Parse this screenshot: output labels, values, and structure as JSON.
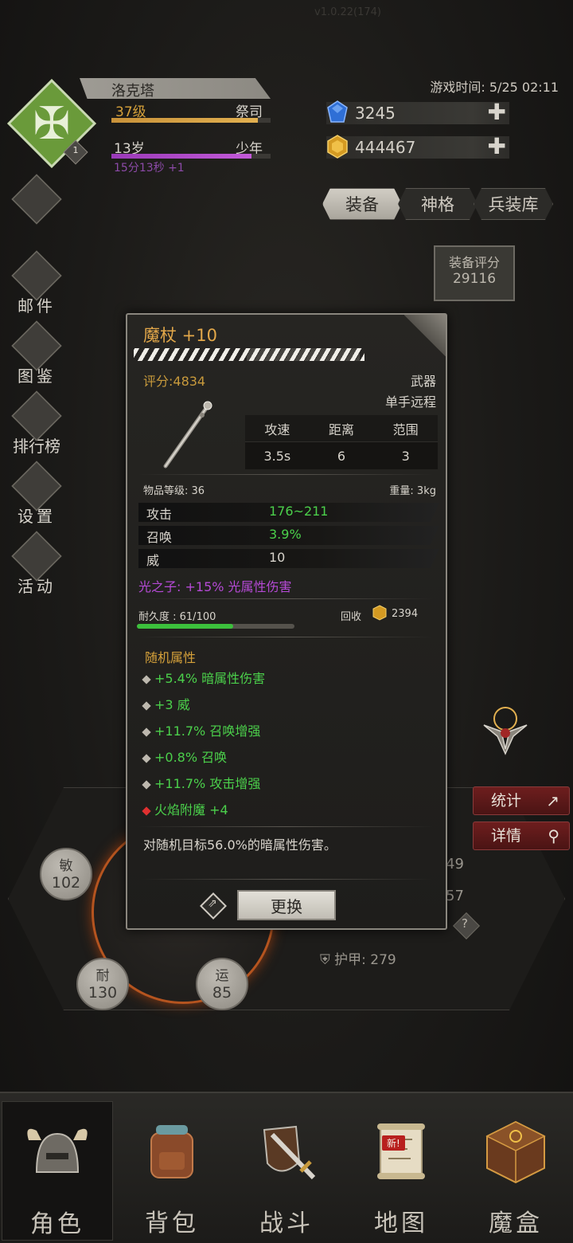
{
  "version": "v1.0.22(174)",
  "game_time": "游戏时间: 5/25 02:11",
  "character": {
    "name": "洛克塔",
    "level": "37级",
    "class": "祭司",
    "age": "13岁",
    "stage": "少年",
    "timer": "15分13秒 +1",
    "rank": "1",
    "level_progress_pct": 92,
    "age_progress_pct": 88
  },
  "currency": {
    "gems": "3245",
    "gold": "444467"
  },
  "tabs": [
    "装备",
    "神格",
    "兵装库"
  ],
  "gear_score": {
    "label": "装备评分",
    "value": "29116"
  },
  "side_menu": [
    {
      "label": "邮件",
      "icon": "mail-icon"
    },
    {
      "label": "图鉴",
      "icon": "book-icon"
    },
    {
      "label": "排行榜",
      "icon": "ranking-icon"
    },
    {
      "label": "设置",
      "icon": "gear-icon"
    },
    {
      "label": "活动",
      "icon": "event-icon"
    }
  ],
  "item": {
    "title": "魔杖 +10",
    "score": "评分:4834",
    "type": "武器",
    "subtype": "单手远程",
    "stat_headers": [
      "攻速",
      "距离",
      "范围"
    ],
    "stat_values": [
      "3.5s",
      "6",
      "3"
    ],
    "item_level": "物品等级: 36",
    "weight": "重量: 3kg",
    "attributes": [
      {
        "name": "攻击",
        "value": "176~211",
        "color": "#4bd04b"
      },
      {
        "name": "召唤",
        "value": "3.9%",
        "color": "#4bd04b"
      },
      {
        "name": "威",
        "value": "10",
        "color": "#d8d4cc"
      }
    ],
    "set_bonus": "光之子: +15% 光属性伤害",
    "durability": "耐久度 : 61/100",
    "durability_pct": 61,
    "recycle_label": "回收",
    "recycle_value": "2394",
    "random_title": "随机属性",
    "random_attrs": [
      {
        "text": "+5.4% 暗属性伤害",
        "marker": "gray"
      },
      {
        "text": "+3 威",
        "marker": "gray"
      },
      {
        "text": "+11.7% 召唤增强",
        "marker": "gray"
      },
      {
        "text": "+0.8% 召唤",
        "marker": "gray"
      },
      {
        "text": "+11.7% 攻击增强",
        "marker": "gray"
      },
      {
        "text": "火焰附魔 +4",
        "marker": "red"
      }
    ],
    "description": "对随机目标56.0%的暗属性伤害。",
    "replace_label": "更换"
  },
  "stats_panel": {
    "attributes": [
      {
        "name": "敏",
        "value": "102"
      },
      {
        "name": "耐",
        "value": "130"
      },
      {
        "name": "运",
        "value": "85"
      }
    ],
    "stats_button": "统计",
    "details_button": "详情",
    "partial_values": [
      "49",
      "57"
    ],
    "armor": "护甲: 279"
  },
  "bottom_nav": [
    {
      "label": "角色",
      "icon": "helmet-icon",
      "active": true
    },
    {
      "label": "背包",
      "icon": "backpack-icon",
      "active": false
    },
    {
      "label": "战斗",
      "icon": "sword-shield-icon",
      "active": false
    },
    {
      "label": "地图",
      "icon": "map-scroll-icon",
      "active": false
    },
    {
      "label": "魔盒",
      "icon": "magic-box-icon",
      "active": false
    }
  ],
  "new_tag": "新!"
}
